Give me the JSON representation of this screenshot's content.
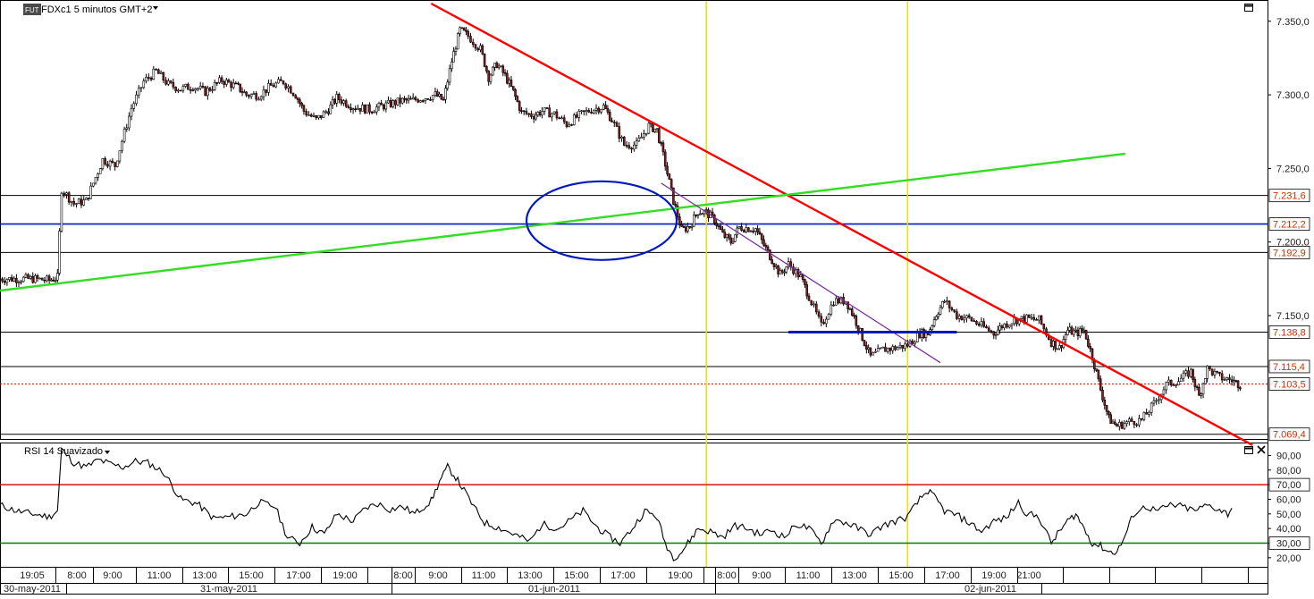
{
  "header": {
    "instrument_badge": "FUT",
    "instrument": "FDXc1",
    "timeframe": "5 minutos",
    "timezone": "GMT+2",
    "dropdown_icon": "triangle-down-icon"
  },
  "rsi_panel": {
    "title": "RSI 14 Suavizado",
    "dropdown_icon": "triangle-down-icon"
  },
  "colors": {
    "price": "#000000",
    "trend_red": "#ff0000",
    "trend_green": "#33dd22",
    "trend_purple": "#7a2a9a",
    "blue_marker": "#0018c0",
    "yellow_vline": "#f0e000",
    "level_label_red": "#d03000",
    "rsi_upper": "#e01010",
    "rsi_lower": "#007a00"
  },
  "icons": {
    "main_maximize": "maximize-icon",
    "rsi_maximize": "maximize-icon",
    "rsi_close": "close-icon"
  },
  "chart_data": [
    {
      "type": "candlestick",
      "y_ticks": [
        "7.350,0",
        "7.300,0",
        "7.250,0",
        "7.200,0",
        "7.150,0"
      ],
      "y_tick_values": [
        7350,
        7300,
        7250,
        7200,
        7150
      ],
      "ylim": [
        7068,
        7362
      ],
      "x_time_ticks": [
        "19:05",
        "8:00",
        "9:00",
        "11:00",
        "13:00",
        "15:00",
        "17:00",
        "19:00",
        "8:00",
        "9:00",
        "11:00",
        "13:00",
        "15:00",
        "17:00",
        "19:00",
        "8:00",
        "9:00",
        "11:00",
        "13:00",
        "15:00",
        "17:00",
        "19:00",
        "21:00"
      ],
      "x_date_ticks": [
        "30-may-2011",
        "31-may-2011",
        "01-jun-2011",
        "02-jun-2011"
      ],
      "horizontal_levels": [
        {
          "value": 7231.6,
          "label": "7.231,6",
          "style": "black"
        },
        {
          "value": 7212.2,
          "label": "7.212,2",
          "style": "blue"
        },
        {
          "value": 7192.9,
          "label": "7.192,9",
          "style": "black"
        },
        {
          "value": 7138.8,
          "label": "7.138,8",
          "style": "black"
        },
        {
          "value": 7115.4,
          "label": "7.115,4",
          "style": "black"
        },
        {
          "value": 7103.5,
          "label": "7.103,5",
          "style": "dotted-red"
        },
        {
          "value": 7069.4,
          "label": "7.069,4",
          "style": "black"
        }
      ],
      "price_path": [
        [
          0,
          7175
        ],
        [
          8,
          7175
        ],
        [
          12,
          7174
        ],
        [
          14,
          7176
        ],
        [
          15,
          7236
        ],
        [
          18,
          7226
        ],
        [
          21,
          7228
        ],
        [
          25,
          7256
        ],
        [
          28,
          7252
        ],
        [
          32,
          7291
        ],
        [
          35,
          7309
        ],
        [
          38,
          7316
        ],
        [
          41,
          7307
        ],
        [
          44,
          7304
        ],
        [
          47,
          7306
        ],
        [
          50,
          7302
        ],
        [
          54,
          7310
        ],
        [
          58,
          7305
        ],
        [
          60,
          7300
        ],
        [
          63,
          7300
        ],
        [
          66,
          7306
        ],
        [
          69,
          7309
        ],
        [
          72,
          7300
        ],
        [
          74,
          7289
        ],
        [
          77,
          7283
        ],
        [
          80,
          7290
        ],
        [
          82,
          7298
        ],
        [
          86,
          7292
        ],
        [
          90,
          7290
        ],
        [
          94,
          7293
        ],
        [
          98,
          7296
        ],
        [
          100,
          7296
        ],
        [
          103,
          7298
        ],
        [
          106,
          7300
        ],
        [
          108,
          7296
        ],
        [
          110,
          7323
        ],
        [
          112,
          7344
        ],
        [
          114,
          7340
        ],
        [
          117,
          7331
        ],
        [
          119,
          7312
        ],
        [
          121,
          7321
        ],
        [
          123,
          7313
        ],
        [
          125,
          7302
        ],
        [
          127,
          7288
        ],
        [
          130,
          7286
        ],
        [
          132,
          7289
        ],
        [
          135,
          7287
        ],
        [
          138,
          7280
        ],
        [
          141,
          7286
        ],
        [
          144,
          7290
        ],
        [
          147,
          7292
        ],
        [
          149,
          7283
        ],
        [
          152,
          7266
        ],
        [
          155,
          7266
        ],
        [
          158,
          7279
        ],
        [
          160,
          7276
        ],
        [
          162,
          7253
        ],
        [
          164,
          7228
        ],
        [
          166,
          7208
        ],
        [
          168,
          7211
        ],
        [
          170,
          7221
        ],
        [
          172,
          7220
        ],
        [
          174,
          7215
        ],
        [
          176,
          7205
        ],
        [
          178,
          7200
        ],
        [
          180,
          7210
        ],
        [
          184,
          7209
        ],
        [
          186,
          7198
        ],
        [
          188,
          7188
        ],
        [
          190,
          7178
        ],
        [
          192,
          7185
        ],
        [
          195,
          7176
        ],
        [
          197,
          7163
        ],
        [
          200,
          7143
        ],
        [
          203,
          7160
        ],
        [
          206,
          7160
        ],
        [
          208,
          7149
        ],
        [
          210,
          7135
        ],
        [
          212,
          7122
        ],
        [
          215,
          7127
        ],
        [
          218,
          7128
        ],
        [
          221,
          7130
        ],
        [
          224,
          7138
        ],
        [
          226,
          7138
        ],
        [
          228,
          7151
        ],
        [
          230,
          7160
        ],
        [
          233,
          7150
        ],
        [
          236,
          7148
        ],
        [
          239,
          7143
        ],
        [
          242,
          7138
        ],
        [
          244,
          7143
        ],
        [
          247,
          7147
        ],
        [
          250,
          7148
        ],
        [
          253,
          7147
        ],
        [
          256,
          7132
        ],
        [
          258,
          7128
        ],
        [
          260,
          7140
        ],
        [
          262,
          7138
        ],
        [
          264,
          7140
        ],
        [
          266,
          7122
        ],
        [
          268,
          7100
        ],
        [
          270,
          7080
        ],
        [
          272,
          7075
        ],
        [
          275,
          7078
        ],
        [
          278,
          7079
        ],
        [
          281,
          7090
        ],
        [
          284,
          7103
        ],
        [
          287,
          7106
        ],
        [
          290,
          7112
        ],
        [
          292,
          7095
        ],
        [
          294,
          7114
        ],
        [
          297,
          7108
        ],
        [
          300,
          7106
        ],
        [
          302,
          7103
        ]
      ],
      "trend_lines": [
        {
          "name": "red-resistance",
          "from": [
            105,
            7362
          ],
          "to": [
            305,
            7062
          ]
        },
        {
          "name": "green-support",
          "from": [
            0,
            7167
          ],
          "to": [
            274,
            7260
          ]
        },
        {
          "name": "purple-channel",
          "from": [
            161,
            7240
          ],
          "to": [
            229,
            7118
          ]
        },
        {
          "name": "blue-segment",
          "from": [
            192,
            7138.8
          ],
          "to": [
            233,
            7138.8
          ]
        }
      ],
      "vertical_markers": [
        172,
        221
      ]
    },
    {
      "type": "line",
      "name": "RSI 14 Suavizado",
      "y_ticks": [
        "90,00",
        "80,00",
        "70,00",
        "60,00",
        "50,00",
        "40,00",
        "30,00",
        "20,00"
      ],
      "y_tick_values": [
        90,
        80,
        70,
        60,
        50,
        40,
        30,
        20
      ],
      "ylim": [
        15,
        97
      ],
      "levels": [
        {
          "value": 70,
          "label": "70,00"
        },
        {
          "value": 30,
          "label": "30,00"
        }
      ],
      "rsi_path": [
        [
          0,
          56
        ],
        [
          4,
          52
        ],
        [
          8,
          50
        ],
        [
          12,
          48
        ],
        [
          14,
          52
        ],
        [
          15,
          94
        ],
        [
          18,
          85
        ],
        [
          21,
          82
        ],
        [
          24,
          87
        ],
        [
          27,
          84
        ],
        [
          30,
          82
        ],
        [
          33,
          86
        ],
        [
          36,
          85
        ],
        [
          40,
          78
        ],
        [
          44,
          60
        ],
        [
          48,
          57
        ],
        [
          52,
          47
        ],
        [
          56,
          48
        ],
        [
          60,
          50
        ],
        [
          63,
          58
        ],
        [
          67,
          55
        ],
        [
          70,
          34
        ],
        [
          73,
          30
        ],
        [
          76,
          41
        ],
        [
          79,
          36
        ],
        [
          82,
          50
        ],
        [
          86,
          45
        ],
        [
          89,
          54
        ],
        [
          92,
          57
        ],
        [
          95,
          53
        ],
        [
          98,
          55
        ],
        [
          101,
          50
        ],
        [
          105,
          59
        ],
        [
          107,
          72
        ],
        [
          109,
          82
        ],
        [
          111,
          75
        ],
        [
          113,
          66
        ],
        [
          116,
          52
        ],
        [
          118,
          44
        ],
        [
          122,
          40
        ],
        [
          126,
          35
        ],
        [
          129,
          31
        ],
        [
          132,
          43
        ],
        [
          136,
          40
        ],
        [
          139,
          46
        ],
        [
          142,
          52
        ],
        [
          145,
          42
        ],
        [
          148,
          35
        ],
        [
          151,
          30
        ],
        [
          154,
          40
        ],
        [
          157,
          52
        ],
        [
          160,
          48
        ],
        [
          162,
          30
        ],
        [
          164,
          20
        ],
        [
          166,
          24
        ],
        [
          168,
          32
        ],
        [
          170,
          40
        ],
        [
          173,
          38
        ],
        [
          176,
          34
        ],
        [
          179,
          42
        ],
        [
          182,
          40
        ],
        [
          185,
          36
        ],
        [
          188,
          39
        ],
        [
          191,
          34
        ],
        [
          194,
          43
        ],
        [
          197,
          40
        ],
        [
          200,
          30
        ],
        [
          203,
          46
        ],
        [
          206,
          44
        ],
        [
          209,
          40
        ],
        [
          212,
          36
        ],
        [
          215,
          42
        ],
        [
          218,
          45
        ],
        [
          221,
          48
        ],
        [
          224,
          60
        ],
        [
          226,
          66
        ],
        [
          228,
          60
        ],
        [
          230,
          52
        ],
        [
          233,
          49
        ],
        [
          236,
          44
        ],
        [
          239,
          38
        ],
        [
          242,
          45
        ],
        [
          245,
          47
        ],
        [
          248,
          58
        ],
        [
          250,
          50
        ],
        [
          253,
          48
        ],
        [
          256,
          30
        ],
        [
          258,
          38
        ],
        [
          260,
          45
        ],
        [
          262,
          50
        ],
        [
          264,
          40
        ],
        [
          266,
          30
        ],
        [
          268,
          28
        ],
        [
          270,
          24
        ],
        [
          272,
          24
        ],
        [
          274,
          35
        ],
        [
          276,
          50
        ],
        [
          279,
          55
        ],
        [
          282,
          52
        ],
        [
          285,
          56
        ],
        [
          288,
          55
        ],
        [
          291,
          52
        ],
        [
          294,
          56
        ],
        [
          297,
          53
        ],
        [
          299,
          50
        ],
        [
          300,
          54
        ]
      ]
    }
  ]
}
